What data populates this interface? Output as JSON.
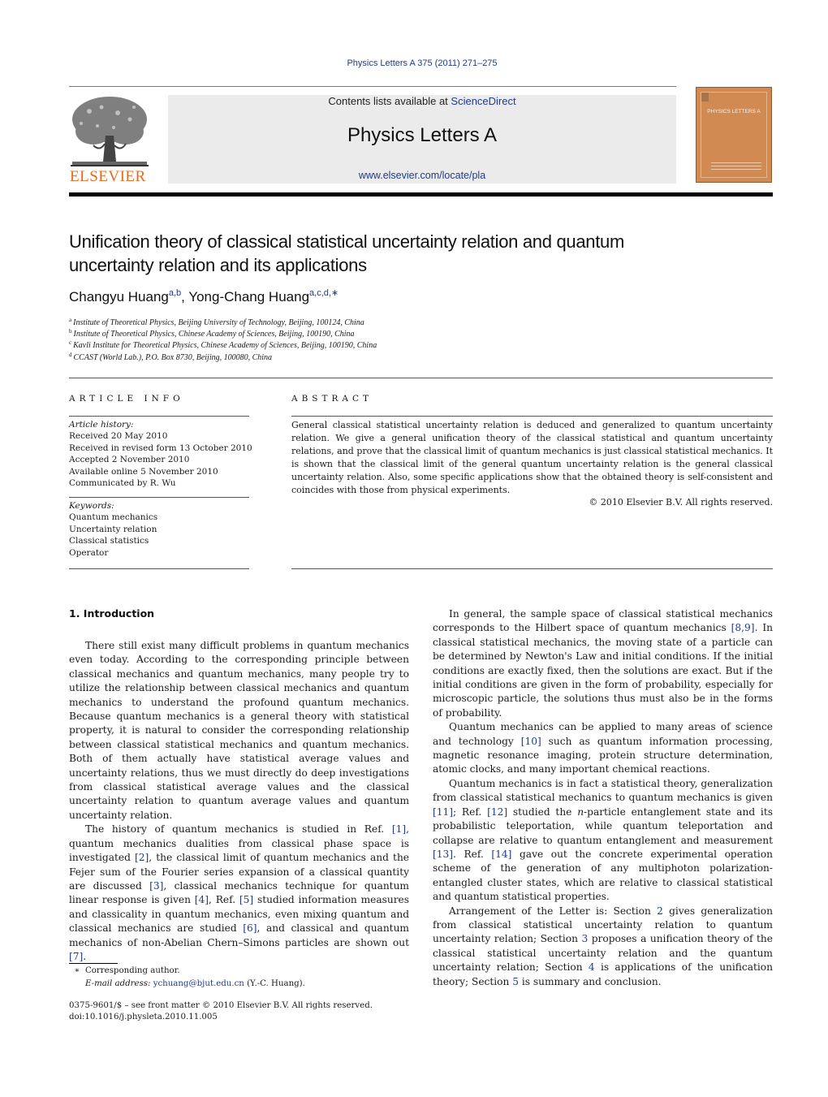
{
  "header": {
    "journal_ref": "Physics Letters A 375 (2011) 271–275",
    "contents_prefix": "Contents lists available at ",
    "contents_link": "ScienceDirect",
    "journal_name": "Physics Letters A",
    "journal_url": "www.elsevier.com/locate/pla",
    "publisher_logo_text": "ELSEVIER",
    "cover_title": "PHYSICS LETTERS A",
    "colors": {
      "publisher_orange": "#e36b1d",
      "link_blue": "#1f3b8f",
      "cover": "#d18a52",
      "banner_gray": "#ebebeb"
    }
  },
  "article": {
    "title_line1": "Unification theory of classical statistical uncertainty relation and quantum",
    "title_line2": "uncertainty relation and its applications",
    "authors": [
      {
        "name": "Changyu Huang",
        "marks": "a,b"
      },
      {
        "name": "Yong-Chang Huang",
        "marks": "a,c,d,∗"
      }
    ],
    "author_separator": ", ",
    "affiliations": [
      {
        "mark": "a",
        "text": "Institute of Theoretical Physics, Beijing University of Technology, Beijing, 100124, China"
      },
      {
        "mark": "b",
        "text": "Institute of Theoretical Physics, Chinese Academy of Sciences, Beijing, 100190, China"
      },
      {
        "mark": "c",
        "text": "Kavli Institute for Theoretical Physics, Chinese Academy of Sciences, Beijing, 100190, China"
      },
      {
        "mark": "d",
        "text": "CCAST (World Lab.), P.O. Box 8730, Beijing, 100080, China"
      }
    ]
  },
  "article_info": {
    "heading": "ARTICLE INFO",
    "history_label": "Article history:",
    "history": [
      "Received 20 May 2010",
      "Received in revised form 13 October 2010",
      "Accepted 2 November 2010",
      "Available online 5 November 2010",
      "Communicated by R. Wu"
    ],
    "keywords_label": "Keywords:",
    "keywords": [
      "Quantum mechanics",
      "Uncertainty relation",
      "Classical statistics",
      "Operator"
    ]
  },
  "abstract": {
    "heading": "ABSTRACT",
    "text": "General classical statistical uncertainty relation is deduced and generalized to quantum uncertainty relation. We give a general unification theory of the classical statistical and quantum uncertainty relations, and prove that the classical limit of quantum mechanics is just classical statistical mechanics. It is shown that the classical limit of the general quantum uncertainty relation is the general classical uncertainty relation. Also, some specific applications show that the obtained theory is self-consistent and coincides with those from physical experiments.",
    "copyright": "© 2010 Elsevier B.V. All rights reserved."
  },
  "intro": {
    "heading": "1. Introduction",
    "left_p1": "There still exist many difficult problems in quantum mechanics even today. According to the corresponding principle between classical mechanics and quantum mechanics, many people try to utilize the relationship between classical mechanics and quantum mechanics to understand the profound quantum mechanics. Because quantum mechanics is a general theory with statistical property, it is natural to consider the corresponding relationship between classical statistical mechanics and quantum mechanics. Both of them actually have statistical average values and uncertainty relations, thus we must directly do deep investigations from classical statistical average values and the classical uncertainty relation to quantum average values and quantum uncertainty relation.",
    "left_p2": {
      "t1": "The history of quantum mechanics is studied in Ref. ",
      "r1": "[1]",
      "t2": ", quantum mechanics dualities from classical phase space is investigated ",
      "r2": "[2]",
      "t3": ", the classical limit of quantum mechanics and the Fejer sum of the Fourier series expansion of a classical quantity are discussed ",
      "r3": "[3]",
      "t4": ", classical mechanics technique for quantum linear response is given ",
      "r4": "[4]",
      "t5": ", Ref. ",
      "r5": "[5]",
      "t6": " studied information measures and classicality in quantum mechanics, even mixing quantum and classical mechanics are studied ",
      "r6": "[6]",
      "t7": ", and classical and quantum mechanics of non-Abelian Chern–Simons particles are shown out ",
      "r7": "[7]",
      "t8": "."
    },
    "right_p1": {
      "t1": "In general, the sample space of classical statistical mechanics corresponds to the Hilbert space of quantum mechanics ",
      "r1": "[8,9]",
      "t2": ". In classical statistical mechanics, the moving state of a particle can be determined by Newton's Law and initial conditions. If the initial conditions are exactly fixed, then the solutions are exact. But if the initial conditions are given in the form of probability, especially for microscopic particle, the solutions thus must also be in the forms of probability."
    },
    "right_p2": {
      "t1": "Quantum mechanics can be applied to many areas of science and technology ",
      "r1": "[10]",
      "t2": " such as quantum information processing, magnetic resonance imaging, protein structure determination, atomic clocks, and many important chemical reactions."
    },
    "right_p3": {
      "t1": "Quantum mechanics is in fact a statistical theory, generalization from classical statistical mechanics to quantum mechanics is given ",
      "r1": "[11]",
      "t2": "; Ref. ",
      "r2": "[12]",
      "t3": " studied the ",
      "n": "n",
      "t4": "-particle entanglement state and its probabilistic teleportation, while quantum teleportation and collapse are relative to quantum entanglement and measurement ",
      "r3": "[13]",
      "t5": ". Ref. ",
      "r4": "[14]",
      "t6": " gave out the concrete experimental operation scheme of the generation of any multiphoton polarization-entangled cluster states, which are relative to classical statistical and quantum statistical properties."
    },
    "right_p4": {
      "t1": "Arrangement of the Letter is: Section ",
      "s2": "2",
      "t2": " gives generalization from classical statistical uncertainty relation to quantum uncertainty relation; Section ",
      "s3": "3",
      "t3": " proposes a unification theory of the classical statistical uncertainty relation and the quantum uncertainty relation; Section ",
      "s4": "4",
      "t4": " is applications of the unification theory; Section ",
      "s5": "5",
      "t5": " is summary and conclusion."
    }
  },
  "footnotes": {
    "star": "∗",
    "corresponding": "Corresponding author.",
    "email_label": "E-mail address:",
    "email": "ychuang@bjut.edu.cn",
    "email_suffix": " (Y.-C. Huang).",
    "issn_line": "0375-9601/$ – see front matter  © 2010 Elsevier B.V. All rights reserved.",
    "doi": "doi:10.1016/j.physleta.2010.11.005"
  }
}
